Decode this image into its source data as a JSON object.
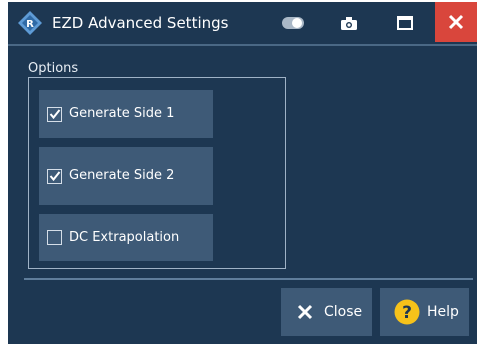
{
  "window": {
    "title": "EZD Advanced Settings"
  },
  "titlebar_icons": {
    "toggle": "toggle-icon",
    "camera": "camera-icon",
    "maximize": "maximize-icon",
    "close": "close-icon"
  },
  "options": {
    "group_label": "Options",
    "items": [
      {
        "label": "Generate Side 1",
        "checked": true
      },
      {
        "label": "Generate Side 2",
        "checked": true
      },
      {
        "label": "DC Extrapolation",
        "checked": false
      }
    ]
  },
  "buttons": {
    "close_label": "Close",
    "help_label": "Help"
  },
  "colors": {
    "window_bg": "#1d3752",
    "button_bg": "#3e5a77",
    "close_red": "#d9463c",
    "help_yellow": "#f6c21a"
  }
}
